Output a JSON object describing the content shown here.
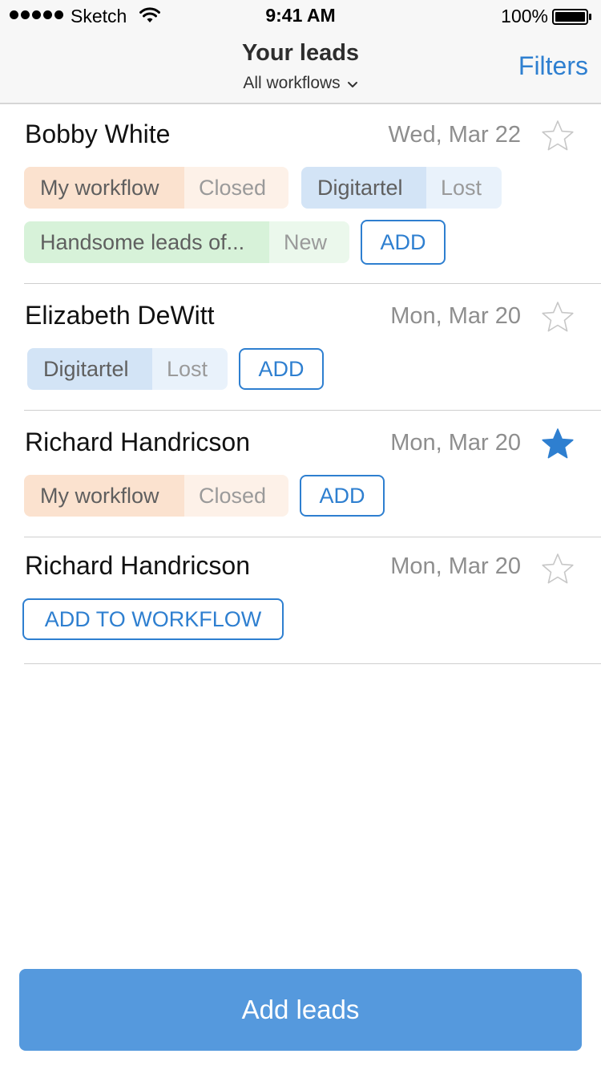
{
  "status_bar": {
    "carrier": "Sketch",
    "time": "9:41 AM",
    "battery": "100%"
  },
  "nav": {
    "title": "Your leads",
    "subtitle": "All workflows",
    "filters_label": "Filters"
  },
  "leads": [
    {
      "name": "Bobby White",
      "date": "Wed, Mar 22",
      "starred": false,
      "tags": [
        {
          "workflow": "My workflow",
          "status": "Closed",
          "color": "#fbe2cf"
        },
        {
          "workflow": "Digitartel",
          "status": "Lost",
          "color": "#d3e4f6"
        },
        {
          "workflow": "Handsome leads of...",
          "status": "New",
          "color": "#d7f2d9"
        }
      ],
      "add_label": "ADD"
    },
    {
      "name": "Elizabeth DeWitt",
      "date": "Mon, Mar 20",
      "starred": false,
      "tags": [
        {
          "workflow": "Digitartel",
          "status": "Lost",
          "color": "#d3e4f6"
        }
      ],
      "add_label": "ADD"
    },
    {
      "name": "Richard Handricson",
      "date": "Mon, Mar 20",
      "starred": true,
      "tags": [
        {
          "workflow": "My workflow",
          "status": "Closed",
          "color": "#fbe2cf"
        }
      ],
      "add_label": "ADD"
    },
    {
      "name": "Richard Handricson",
      "date": "Mon, Mar 20",
      "starred": false,
      "tags": [],
      "add_label": "ADD TO WORKFLOW"
    }
  ],
  "footer": {
    "add_leads_label": "Add leads"
  },
  "colors": {
    "accent": "#2e7fd0",
    "primary_button": "#5599dd",
    "star_filled": "#2e7fd0",
    "star_empty": "#c7c7c7"
  }
}
